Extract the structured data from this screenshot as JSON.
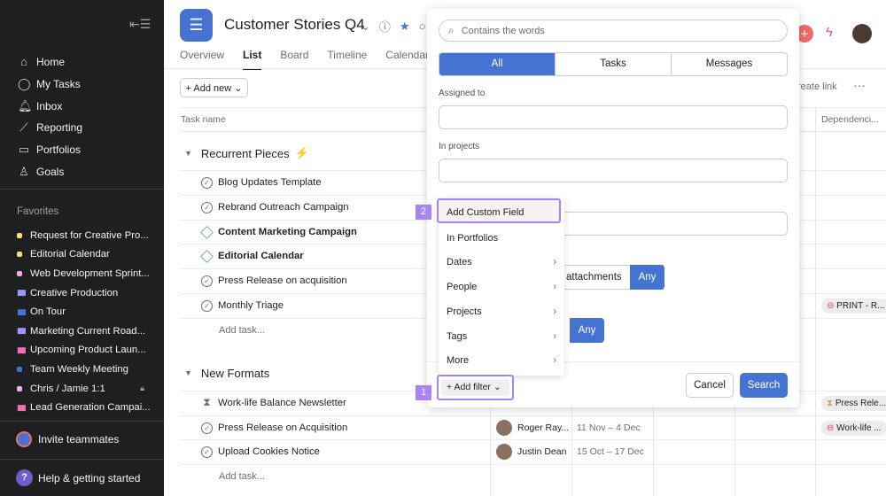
{
  "sidebar": {
    "nav": [
      {
        "label": "Home",
        "icon": "home-icon",
        "glyph": "⌂"
      },
      {
        "label": "My Tasks",
        "icon": "check-circle-icon",
        "glyph": "◯"
      },
      {
        "label": "Inbox",
        "icon": "bell-icon",
        "glyph": "🔔︎"
      },
      {
        "label": "Reporting",
        "icon": "trend-line-icon",
        "glyph": "⟋"
      },
      {
        "label": "Portfolios",
        "icon": "folder-icon",
        "glyph": "▭"
      },
      {
        "label": "Goals",
        "icon": "person-icon",
        "glyph": "♙"
      }
    ],
    "favorites_title": "Favorites",
    "favorites": [
      {
        "label": "Request for Creative Pro...",
        "kind": "dot",
        "color": "#f8df72"
      },
      {
        "label": "Editorial Calendar",
        "kind": "dot",
        "color": "#f8df72"
      },
      {
        "label": "Web Development Sprint...",
        "kind": "dot",
        "color": "#f9aaef"
      },
      {
        "label": "Creative Production",
        "kind": "bars",
        "color": "#9e97f7"
      },
      {
        "label": "On Tour",
        "kind": "bars",
        "color": "#4573d2"
      },
      {
        "label": "Marketing Current Road...",
        "kind": "bars",
        "color": "#9e97f7"
      },
      {
        "label": "Upcoming Product Laun...",
        "kind": "bars",
        "color": "#f26fb2"
      },
      {
        "label": "Team Weekly Meeting",
        "kind": "dot",
        "color": "#4573d2"
      },
      {
        "label": "Chris / Jamie 1:1",
        "kind": "dot",
        "color": "#f9aaef",
        "locked": true
      },
      {
        "label": "Lead Generation Campai...",
        "kind": "bars",
        "color": "#f26fb2"
      }
    ],
    "invite": "Invite teammates",
    "help": "Help & getting started"
  },
  "header": {
    "title": "Customer Stories Q4",
    "tabs": [
      "Overview",
      "List",
      "Board",
      "Timeline",
      "Calendar"
    ],
    "active_tab": "List",
    "add_new": "+ Add new ⌄",
    "create_link": "reate link",
    "more": "···"
  },
  "columns": {
    "task_name": "Task name",
    "dependencies": "Dependenci..."
  },
  "sections": [
    {
      "title": "Recurrent Pieces",
      "emoji": "⚡",
      "tasks": [
        {
          "name": "Blog Updates Template",
          "icon": "check"
        },
        {
          "name": "Rebrand Outreach Campaign",
          "icon": "check"
        },
        {
          "name": "Content Marketing Campaign",
          "icon": "milestone",
          "bold": true
        },
        {
          "name": "Editorial Calendar",
          "icon": "milestone",
          "bold": true
        },
        {
          "name": "Press Release on acquisition",
          "icon": "check"
        },
        {
          "name": "Monthly Triage",
          "icon": "check",
          "dependency": "PRINT - R..."
        }
      ],
      "add_task": "Add task..."
    },
    {
      "title": "New Formats",
      "emoji": "",
      "tasks": [
        {
          "name": "Work-life Balance Newsletter",
          "icon": "hourglass",
          "dependency": "Press Rele..."
        },
        {
          "name": "Press Release on Acquisition",
          "icon": "check",
          "assignee": "Roger Ray...",
          "dates": "11 Nov – 4 Dec",
          "dependency": "Work-life ..."
        },
        {
          "name": "Upload Cookies Notice",
          "icon": "check",
          "assignee": "Justin Dean",
          "dates": "15 Oct – 17 Dec"
        }
      ],
      "add_task": "Add task..."
    }
  ],
  "search": {
    "placeholder": "Contains the words",
    "scopes": [
      "All",
      "Tasks",
      "Messages"
    ],
    "active_scope": "All",
    "assigned_to_label": "Assigned to",
    "in_projects_label": "In projects",
    "attachments_label": "attachments",
    "any_label": "Any",
    "any_label_2": "Any",
    "cancel": "Cancel",
    "submit": "Search"
  },
  "filter_menu": {
    "items": [
      {
        "label": "Add Custom Field",
        "submenu": false
      },
      {
        "label": "In Portfolios",
        "submenu": false
      },
      {
        "label": "Dates",
        "submenu": true
      },
      {
        "label": "People",
        "submenu": true
      },
      {
        "label": "Projects",
        "submenu": true
      },
      {
        "label": "Tags",
        "submenu": true
      },
      {
        "label": "More",
        "submenu": true
      }
    ],
    "add_filter": "+ Add filter ⌄"
  },
  "callouts": [
    "1",
    "2"
  ],
  "colors": {
    "accent": "#4573d2",
    "callout": "#a784f5",
    "sidebar_bg": "#1e1f21"
  }
}
